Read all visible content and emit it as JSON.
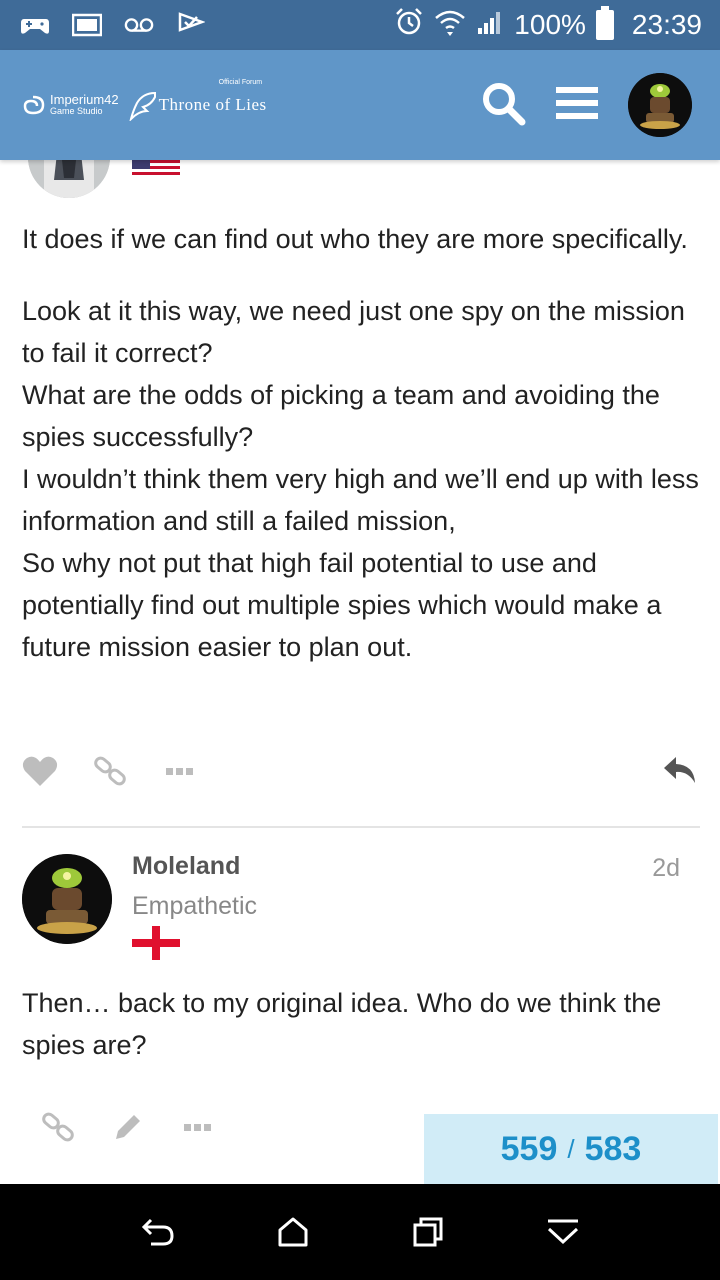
{
  "status_bar": {
    "battery": "100%",
    "time": "23:39",
    "icons": [
      "game-controller-icon",
      "image-icon",
      "voicemail-icon",
      "check-flag-icon",
      "alarm-icon",
      "wifi-icon",
      "signal-icon",
      "battery-icon"
    ]
  },
  "header": {
    "studio_name": "Imperium42",
    "studio_sub": "Game Studio",
    "forum_label": "Official Forum",
    "forum_name": "Throne of Lies",
    "icons": [
      "search-icon",
      "hamburger-menu-icon",
      "user-avatar"
    ],
    "bg_color": "#6096c8"
  },
  "post1": {
    "paragraph1": "It does if we can find out who they are more specifically.",
    "lines": [
      "Look at it this way, we need just one spy on the mission to fail it correct?",
      "What are the odds of picking a team and avoiding the spies successfully?",
      "I wouldn’t think them very high and we’ll end up with less information and still a failed mission,",
      "So why not put that high fail potential to use and potentially find out multiple spies which would make a future mission easier to plan out."
    ],
    "actions": [
      "like-icon",
      "link-icon",
      "more-icon",
      "reply-icon"
    ]
  },
  "post2": {
    "username": "Moleland",
    "user_title": "Empathetic",
    "time": "2d",
    "body": "Then… back to my original idea. Who do we think the spies are?",
    "actions": [
      "link-icon",
      "edit-icon",
      "more-icon"
    ]
  },
  "progress": {
    "current": "559",
    "separator": "/",
    "total": "583"
  },
  "nav": [
    "back-icon",
    "home-icon",
    "recents-icon",
    "collapse-icon"
  ]
}
